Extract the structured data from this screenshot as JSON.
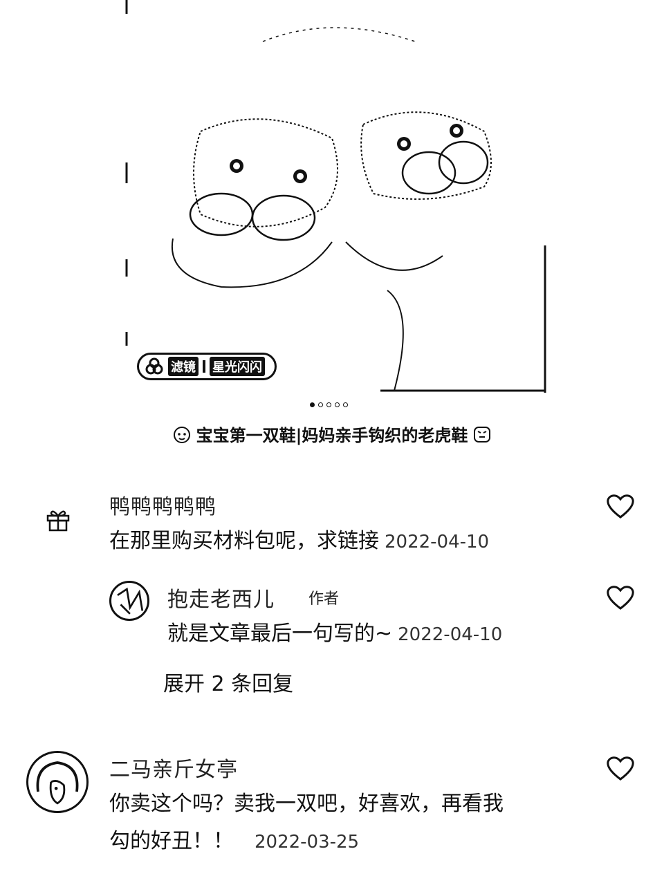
{
  "photo": {
    "filter_label": "滤镜",
    "filter_name": "星光闪闪",
    "page_count": 5,
    "active_page": 1
  },
  "caption": {
    "text": "宝宝第一双鞋|妈妈亲手钩织的老虎鞋"
  },
  "comments": [
    {
      "user": "鸭鸭鸭鸭鸭",
      "text": "在那里购买材料包呢，求链接",
      "date": "2022-04-10"
    },
    {
      "user": "抱走老西儿",
      "badge": "作者",
      "text": "就是文章最后一句写的~",
      "date": "2022-04-10",
      "expand_label": "展开 2 条回复"
    },
    {
      "user": "二马亲斤女亭",
      "text_line1": "你卖这个吗？卖我一双吧，好喜欢，再看我",
      "text_line2": "勾的好丑！！",
      "date": "2022-03-25"
    }
  ],
  "icons": [
    "gift-icon",
    "heart-icon",
    "filter-icon"
  ]
}
